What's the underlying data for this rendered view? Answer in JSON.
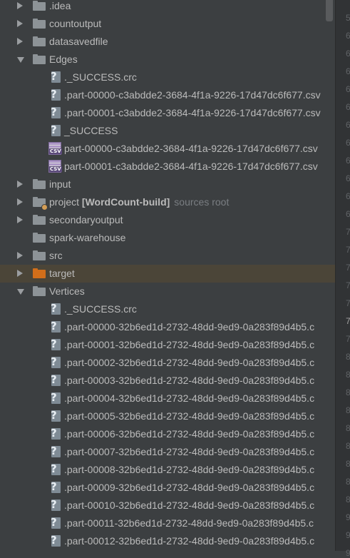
{
  "tree": [
    {
      "label": "idea-folder",
      "text": ".idea",
      "type": "folder",
      "arrow": "collapsed",
      "level": 0
    },
    {
      "text": "countoutput",
      "type": "folder",
      "arrow": "collapsed",
      "level": 0
    },
    {
      "text": "datasavedfile",
      "type": "folder",
      "arrow": "collapsed",
      "level": 0
    },
    {
      "text": "Edges",
      "type": "folder",
      "arrow": "expanded",
      "level": 0
    },
    {
      "text": "._SUCCESS.crc",
      "type": "text",
      "level": 1
    },
    {
      "text": ".part-00000-c3abdde2-3684-4f1a-9226-17d47dc6f677.csv",
      "type": "text",
      "level": 1
    },
    {
      "text": ".part-00001-c3abdde2-3684-4f1a-9226-17d47dc6f677.csv",
      "type": "text",
      "level": 1
    },
    {
      "text": "_SUCCESS",
      "type": "text",
      "level": 1
    },
    {
      "text": "part-00000-c3abdde2-3684-4f1a-9226-17d47dc6f677.csv",
      "type": "csv",
      "level": 1
    },
    {
      "text": "part-00001-c3abdde2-3684-4f1a-9226-17d47dc6f677.csv",
      "type": "csv",
      "level": 1
    },
    {
      "text": "input",
      "type": "folder",
      "arrow": "collapsed",
      "level": 0
    },
    {
      "text": "project",
      "bold": "[WordCount-build]",
      "hint": "sources root",
      "type": "folder-module",
      "arrow": "collapsed",
      "level": 0
    },
    {
      "text": "secondaryoutput",
      "type": "folder",
      "arrow": "collapsed",
      "level": 0
    },
    {
      "text": "spark-warehouse",
      "type": "folder",
      "arrow": "none",
      "level": 0
    },
    {
      "text": "src",
      "type": "folder",
      "arrow": "collapsed",
      "level": 0
    },
    {
      "text": "target",
      "type": "folder-orange",
      "arrow": "collapsed",
      "level": 0,
      "selected": true
    },
    {
      "text": "Vertices",
      "type": "folder",
      "arrow": "expanded",
      "level": 0
    },
    {
      "text": "._SUCCESS.crc",
      "type": "text",
      "level": 1
    },
    {
      "text": ".part-00000-32b6ed1d-2732-48dd-9ed9-0a283f89d4b5.c",
      "type": "text",
      "level": 1
    },
    {
      "text": ".part-00001-32b6ed1d-2732-48dd-9ed9-0a283f89d4b5.c",
      "type": "text",
      "level": 1
    },
    {
      "text": ".part-00002-32b6ed1d-2732-48dd-9ed9-0a283f89d4b5.c",
      "type": "text",
      "level": 1
    },
    {
      "text": ".part-00003-32b6ed1d-2732-48dd-9ed9-0a283f89d4b5.c",
      "type": "text",
      "level": 1
    },
    {
      "text": ".part-00004-32b6ed1d-2732-48dd-9ed9-0a283f89d4b5.c",
      "type": "text",
      "level": 1
    },
    {
      "text": ".part-00005-32b6ed1d-2732-48dd-9ed9-0a283f89d4b5.c",
      "type": "text",
      "level": 1
    },
    {
      "text": ".part-00006-32b6ed1d-2732-48dd-9ed9-0a283f89d4b5.c",
      "type": "text",
      "level": 1
    },
    {
      "text": ".part-00007-32b6ed1d-2732-48dd-9ed9-0a283f89d4b5.c",
      "type": "text",
      "level": 1
    },
    {
      "text": ".part-00008-32b6ed1d-2732-48dd-9ed9-0a283f89d4b5.c",
      "type": "text",
      "level": 1
    },
    {
      "text": ".part-00009-32b6ed1d-2732-48dd-9ed9-0a283f89d4b5.c",
      "type": "text",
      "level": 1
    },
    {
      "text": ".part-00010-32b6ed1d-2732-48dd-9ed9-0a283f89d4b5.c",
      "type": "text",
      "level": 1
    },
    {
      "text": ".part-00011-32b6ed1d-2732-48dd-9ed9-0a283f89d4b5.c",
      "type": "text",
      "level": 1
    },
    {
      "text": ".part-00012-32b6ed1d-2732-48dd-9ed9-0a283f89d4b5.c",
      "type": "text",
      "level": 1
    }
  ],
  "gutter": [
    "5",
    "6",
    "6",
    "6",
    "6",
    "6",
    "6",
    "6",
    "6",
    "6",
    "6",
    "6",
    "7",
    "7",
    "7",
    "7",
    "7",
    "7",
    "7",
    "8",
    "8",
    "8",
    "8",
    "8",
    "8",
    "8",
    "8",
    "8",
    "9",
    "9",
    "9"
  ],
  "gutter_current_index": 17,
  "colors": {
    "panel": "#3c3f41",
    "selection": "#4b4538",
    "text": "#bbbbbb",
    "hint": "#7a7e82",
    "folder": "#8d9397",
    "target_folder": "#d26e1a"
  },
  "icons": {
    "folder": "folder-icon",
    "text_file": "unknown-file-icon",
    "csv_file": "csv-file-icon",
    "expand": "chevron-down-icon",
    "collapse": "chevron-right-icon"
  }
}
